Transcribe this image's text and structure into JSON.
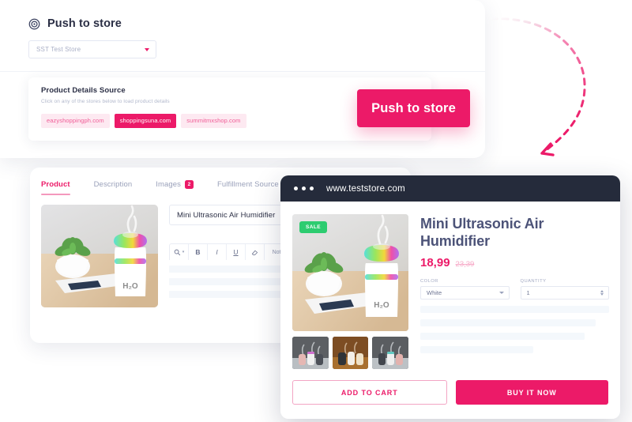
{
  "panel": {
    "icon": "target-icon",
    "title": "Push to store",
    "store_select": {
      "value": "SST Test Store",
      "chevron": "chevron-down-icon"
    }
  },
  "source_card": {
    "title": "Product Details Source",
    "subtitle": "Click on any of the stores below to load product details",
    "stores": [
      {
        "label": "eazyshoppingph.com",
        "active": false
      },
      {
        "label": "shoppingsuna.com",
        "active": true
      },
      {
        "label": "summitmxshop.com",
        "active": false
      }
    ]
  },
  "push_button": {
    "label": "Push to store",
    "color": "#ec1a68"
  },
  "editor": {
    "tabs": [
      {
        "label": "Product",
        "active": true,
        "badge": ""
      },
      {
        "label": "Description",
        "active": false,
        "badge": ""
      },
      {
        "label": "Images",
        "active": false,
        "badge": "2"
      },
      {
        "label": "Fulfillment Source",
        "active": false,
        "badge": ""
      }
    ],
    "title_field": {
      "value": "Mini Ultrasonic Air Humidifier"
    },
    "rte_buttons": [
      "format-icon",
      "B",
      "I",
      "U",
      "eraser-icon",
      "Note"
    ]
  },
  "browser": {
    "url": "www.teststore.com",
    "dots": 3,
    "product": {
      "sale_badge": "SALE",
      "title": "Mini Ultrasonic Air Humidifier",
      "price": "18,99",
      "compare_at_price": "23,39",
      "options": [
        {
          "label": "COLOR",
          "value": "White",
          "control": "select"
        },
        {
          "label": "QUANTITY",
          "value": "1",
          "control": "stepper"
        }
      ],
      "thumbnails": 3,
      "skeleton_lines": 4,
      "add_to_cart": "ADD TO CART",
      "buy_now": "BUY IT NOW"
    }
  },
  "colors": {
    "accent_pink": "#ec1a68",
    "soft_pink": "#fde9f1",
    "sale_green": "#2dcc70",
    "browser_bar": "#252b3b",
    "heading_slate": "#4c5378"
  }
}
